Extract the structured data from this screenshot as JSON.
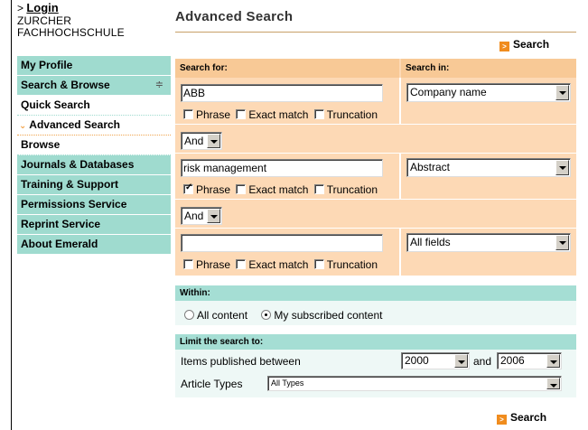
{
  "header": {
    "login_prefix": ">",
    "login_label": "Login",
    "institution": "ZURCHER FACHHOCHSCHULE"
  },
  "sidebar": {
    "items": [
      {
        "label": "My Profile"
      },
      {
        "label": "Search & Browse",
        "expander": "≑"
      },
      {
        "label": "Quick Search"
      },
      {
        "label": "Advanced Search",
        "prefix": "⌄"
      },
      {
        "label": "Browse"
      },
      {
        "label": "Journals & Databases"
      },
      {
        "label": "Training & Support"
      },
      {
        "label": "Permissions Service"
      },
      {
        "label": "Reprint Service"
      },
      {
        "label": "About Emerald"
      }
    ]
  },
  "main": {
    "title": "Advanced Search",
    "search_button": "Search",
    "columns": {
      "search_for": "Search for:",
      "search_in": "Search in:"
    },
    "rows": [
      {
        "query": "ABB",
        "field": "Company name",
        "phrase": false,
        "exact": false,
        "truncation": false
      },
      {
        "query": "risk management",
        "field": "Abstract",
        "phrase": true,
        "exact": false,
        "truncation": false
      },
      {
        "query": "",
        "field": "All fields",
        "phrase": false,
        "exact": false,
        "truncation": false
      }
    ],
    "operators": [
      "And",
      "And"
    ],
    "option_labels": {
      "phrase": "Phrase",
      "exact": "Exact match",
      "truncation": "Truncation"
    },
    "within": {
      "header": "Within:",
      "options": [
        "All content",
        "My subscribed content"
      ],
      "selected": "My subscribed content"
    },
    "limit": {
      "header": "Limit the search to:",
      "published_label": "Items published between",
      "year_from": "2000",
      "and_label": "and",
      "year_to": "2006",
      "article_types_label": "Article Types",
      "article_type": "All Types"
    }
  },
  "colors": {
    "nav_green": "#9fdbcf",
    "panel_peach": "#fdd9b5",
    "header_peach": "#f8c996",
    "accent_orange": "#f08c1e",
    "teal_header": "#a5ded4"
  }
}
